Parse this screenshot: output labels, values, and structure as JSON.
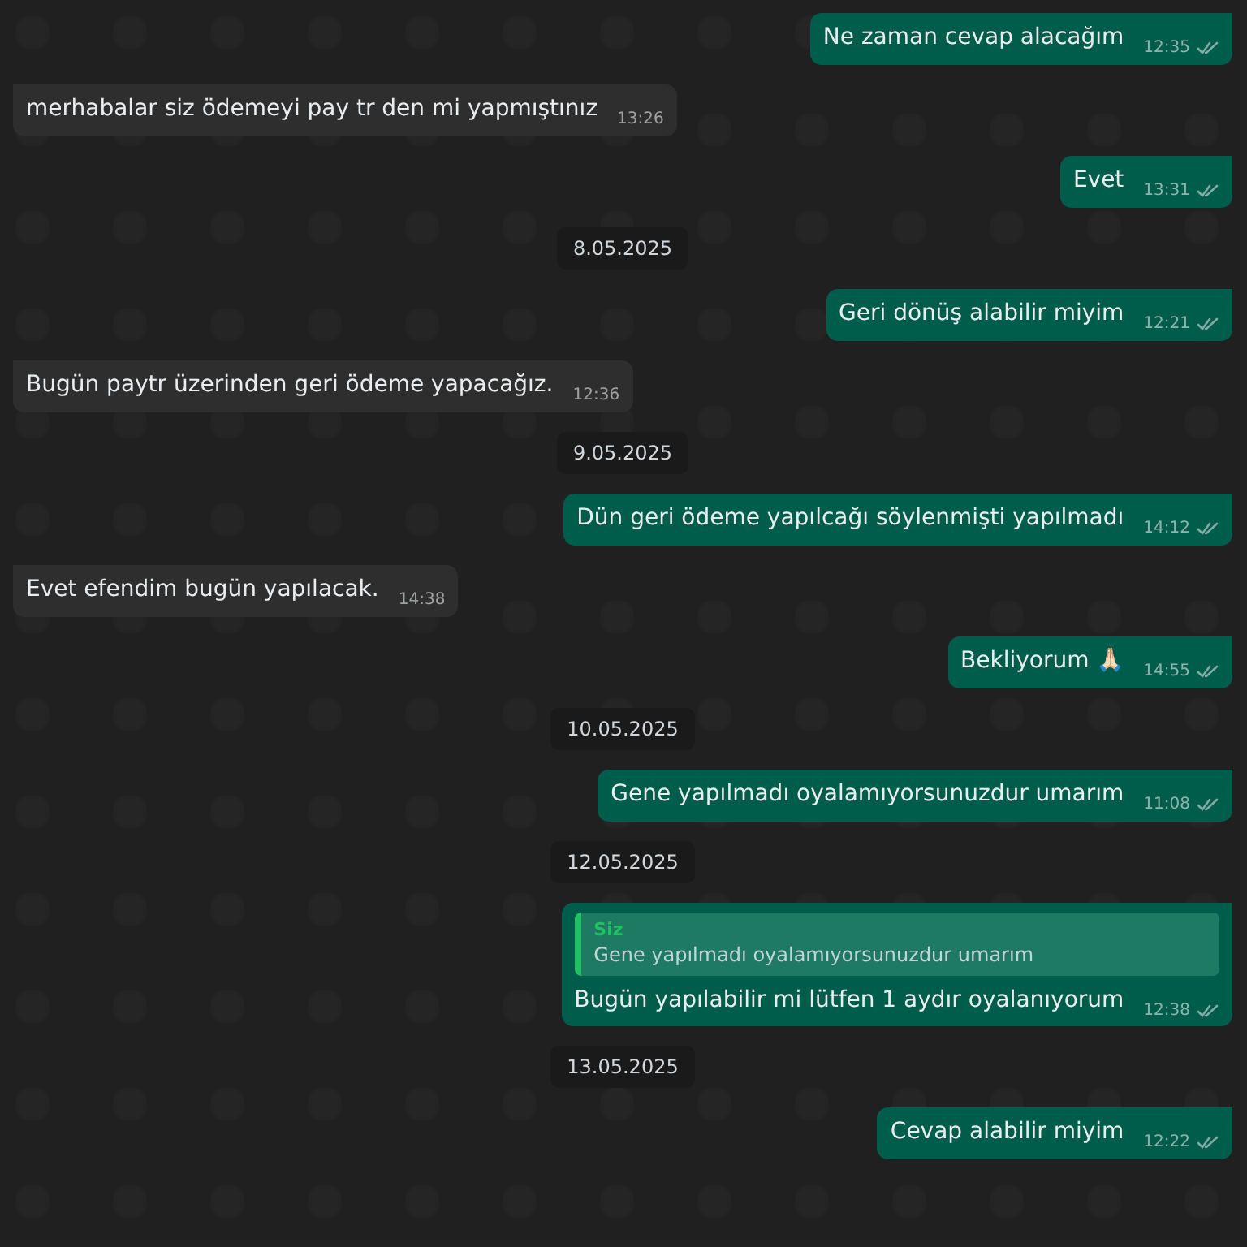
{
  "messages": [
    {
      "kind": "outgoing",
      "text": "Ne zaman cevap alacağım",
      "time": "12:35"
    },
    {
      "kind": "incoming",
      "text": "merhabalar siz ödemeyi pay tr den mi yapmıştınız",
      "time": "13:26"
    },
    {
      "kind": "outgoing",
      "text": "Evet",
      "time": "13:31"
    },
    {
      "kind": "date",
      "text": "8.05.2025"
    },
    {
      "kind": "outgoing",
      "text": "Geri dönüş alabilir miyim",
      "time": "12:21"
    },
    {
      "kind": "incoming",
      "text": "Bugün paytr üzerinden geri ödeme yapacağız.",
      "time": "12:36"
    },
    {
      "kind": "date",
      "text": "9.05.2025"
    },
    {
      "kind": "outgoing",
      "text": "Dün geri ödeme yapılcağı söylenmişti yapılmadı",
      "time": "14:12"
    },
    {
      "kind": "incoming",
      "text": "Evet efendim bugün yapılacak.",
      "time": "14:38"
    },
    {
      "kind": "outgoing",
      "text": "Bekliyorum 🙏🏻",
      "time": "14:55"
    },
    {
      "kind": "date",
      "text": "10.05.2025"
    },
    {
      "kind": "outgoing",
      "text": "Gene yapılmadı oyalamıyorsunuzdur umarım",
      "time": "11:08"
    },
    {
      "kind": "date",
      "text": "12.05.2025"
    },
    {
      "kind": "outgoing",
      "text": "Bugün yapılabilir mi lütfen 1 aydır oyalanıyorum",
      "time": "12:38",
      "quote": {
        "author": "Siz",
        "text": "Gene yapılmadı oyalamıyorsunuzdur umarım"
      }
    },
    {
      "kind": "date",
      "text": "13.05.2025"
    },
    {
      "kind": "outgoing",
      "text": "Cevap alabilir miyim",
      "time": "12:22"
    }
  ]
}
